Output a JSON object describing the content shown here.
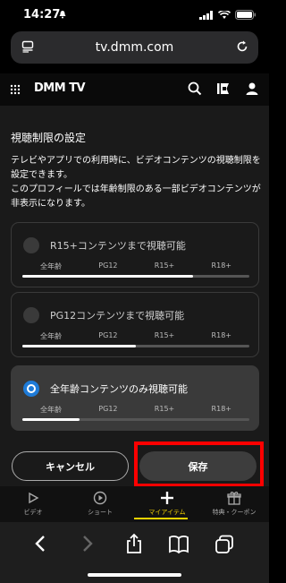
{
  "status": {
    "time": "14:27",
    "bell": "bell-icon",
    "signal": "signal-icon",
    "wifi": "wifi-icon",
    "battery": "battery-icon"
  },
  "browser": {
    "url": "tv.dmm.com",
    "left_icon": "page-icon",
    "reload_icon": "reload-icon"
  },
  "header": {
    "logo": "DMM TV",
    "icons": [
      "search-icon",
      "cast-icon",
      "profile-icon"
    ]
  },
  "page": {
    "title": "視聴制限の設定",
    "description_1": "テレビやアプリでの利用時に、ビデオコンテンツの視聴制限を設定できます。",
    "description_2": "このプロフィールでは年齢制限のある一部ビデオコンテンツが非表示になります。"
  },
  "ticks": [
    "全年齢",
    "PG12",
    "R15+",
    "R18+"
  ],
  "options": [
    {
      "label": "R15+コンテンツまで視聴可能",
      "selected": false,
      "level": 0.75
    },
    {
      "label": "PG12コンテンツまで視聴可能",
      "selected": false,
      "level": 0.5
    },
    {
      "label": "全年齢コンテンツのみ視聴可能",
      "selected": true,
      "level": 0.25
    }
  ],
  "buttons": {
    "cancel": "キャンセル",
    "save": "保存"
  },
  "appnav": [
    {
      "label": "ビデオ",
      "icon": "play-icon",
      "active": false
    },
    {
      "label": "ショート",
      "icon": "short-play-icon",
      "active": false
    },
    {
      "label": "マイアイテム",
      "icon": "plus-icon",
      "active": true
    },
    {
      "label": "特典・クーポン",
      "icon": "gift-icon",
      "active": false
    }
  ],
  "colors": {
    "accent": "#1e7bd8",
    "highlight": "#ff0000",
    "active_nav": "#f5d300"
  }
}
